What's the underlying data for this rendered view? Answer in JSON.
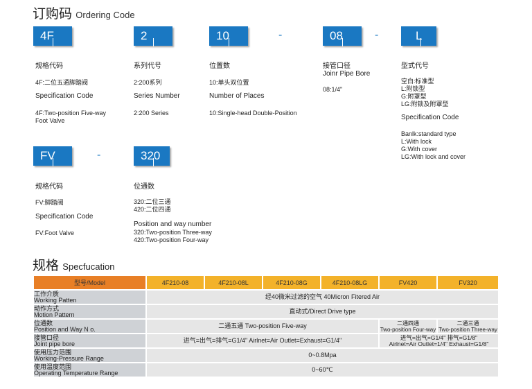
{
  "ordering": {
    "title_cn": "订购码",
    "title_en": "Ordering Code",
    "dash": "-",
    "codes": {
      "c1": "4F",
      "c2": "2",
      "c3": "10",
      "c4": "08",
      "c5": "L",
      "c6": "FV",
      "c7": "320"
    },
    "col1": {
      "cn_label": "规格代码",
      "cn_desc": "4F:二位五通脚踏阀",
      "en_label": "Specification Code",
      "en_desc1": "4F:Two-position Five-way",
      "en_desc2": "Foot Valve"
    },
    "col2": {
      "cn_label": "系列代号",
      "cn_desc": "2:200系列",
      "en_label": "Series Number",
      "en_desc": "2:200 Series"
    },
    "col3": {
      "cn_label": "位置数",
      "cn_desc": "10:单头双位置",
      "en_label": "Number of Places",
      "en_desc": "10:Single-head Double-Position"
    },
    "col4": {
      "cn_label": "接管口径",
      "en_label": "Joinr Pipe Bore",
      "desc": "08:1/4\""
    },
    "col5": {
      "cn_label": "型式代号",
      "cn_lines": [
        "空白:标准型",
        "L:附锁型",
        "G:附罩型",
        "LG:附锁及附罩型"
      ],
      "en_label": "Specification Code",
      "en_lines": [
        "Banlk:standard type",
        "L:With lock",
        "G:With cover",
        "LG:With lock and cover"
      ]
    },
    "col6": {
      "cn_label": "规格代码",
      "cn_desc": "FV:脚踏阀",
      "en_label": "Specification Code",
      "en_desc": "FV:Foot Valve"
    },
    "col7": {
      "cn_label": "位通数",
      "cn_lines": [
        "320:二位三通",
        "420:二位四通"
      ],
      "en_label": "Position and way number",
      "en_lines": [
        "320:Two-position Three-way",
        "420:Two-position Four-way"
      ]
    }
  },
  "spec": {
    "title_cn": "规格",
    "title_en": "Specfucation",
    "headers": [
      "型号/Model",
      "4F210-08",
      "4F210-08L",
      "4F210-08G",
      "4F210-08LG",
      "FV420",
      "FV320"
    ],
    "rows": {
      "medium": {
        "cn": "工作介质",
        "en": "Working Patten",
        "value": "经40微米过滤的空气 40Micron Fitered Air"
      },
      "motion": {
        "cn": "动作方式",
        "en": "Motion Pattern",
        "value": "直动式/Direct Drive type"
      },
      "position": {
        "cn": "位通数",
        "en": "Position and Way N o.",
        "value_main": "二通五通 Two-position Five-way",
        "fv420_cn": "二通四通",
        "fv420_en": "Two-position Four-way",
        "fv320_cn": "二通三通",
        "fv320_en": "Two-position Three-way"
      },
      "pipe": {
        "cn": "接管口径",
        "en": "Joint pipe bore",
        "value_main": "进气=出气=排气=G1/4\" Airlnet=Air Outlet=Exhaust=G1/4\"",
        "fv_line1": "进气=出气=G1/4\"  排气=G1/8\"",
        "fv_line2": "Airlnet=Air Outlet=1/4\"  Exhaust=G1/8\""
      },
      "pressure": {
        "cn": "使用压力范围",
        "en": "Working-Pressure Range",
        "value": "0~0.8Mpa"
      },
      "temperature": {
        "cn": "使用温度范围",
        "en": "Operating Temperature Range",
        "value": "0~60℃"
      }
    }
  }
}
